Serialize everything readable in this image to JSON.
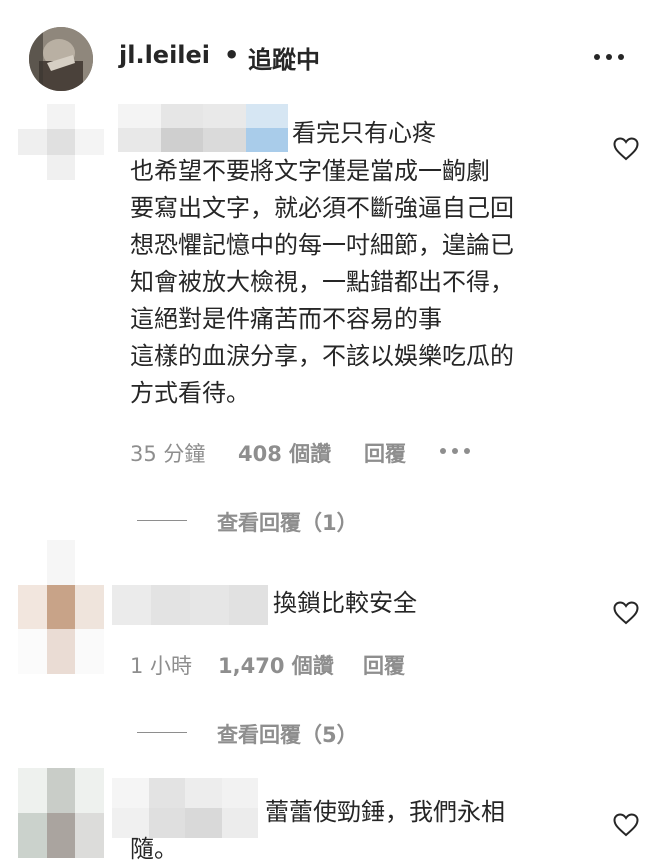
{
  "header": {
    "username": "jl.leilei",
    "separator": "•",
    "follow_status": "追蹤中"
  },
  "comments": [
    {
      "lines": [
        "看完只有心疼",
        "也希望不要將文字僅是當成一齣劇",
        "要寫出文字，就必須不斷強逼自己回",
        "想恐懼記憶中的每一吋細節，遑論已",
        "知會被放大檢視，一點錯都出不得，",
        "這絕對是件痛苦而不容易的事",
        "這樣的血淚分享，不該以娛樂吃瓜的",
        "方式看待。"
      ],
      "time": "35 分鐘",
      "likes": "408 個讚",
      "reply": "回覆",
      "view_replies": "查看回覆（1）"
    },
    {
      "lines": [
        "換鎖比較安全"
      ],
      "time": "1 小時",
      "likes": "1,470 個讚",
      "reply": "回覆",
      "view_replies": "查看回覆（5）"
    },
    {
      "lines": [
        "蕾蕾使勁錘，我們永相",
        "隨。"
      ]
    }
  ],
  "icons": {
    "like": "heart-outline-icon",
    "more": "more-horizontal-icon"
  }
}
